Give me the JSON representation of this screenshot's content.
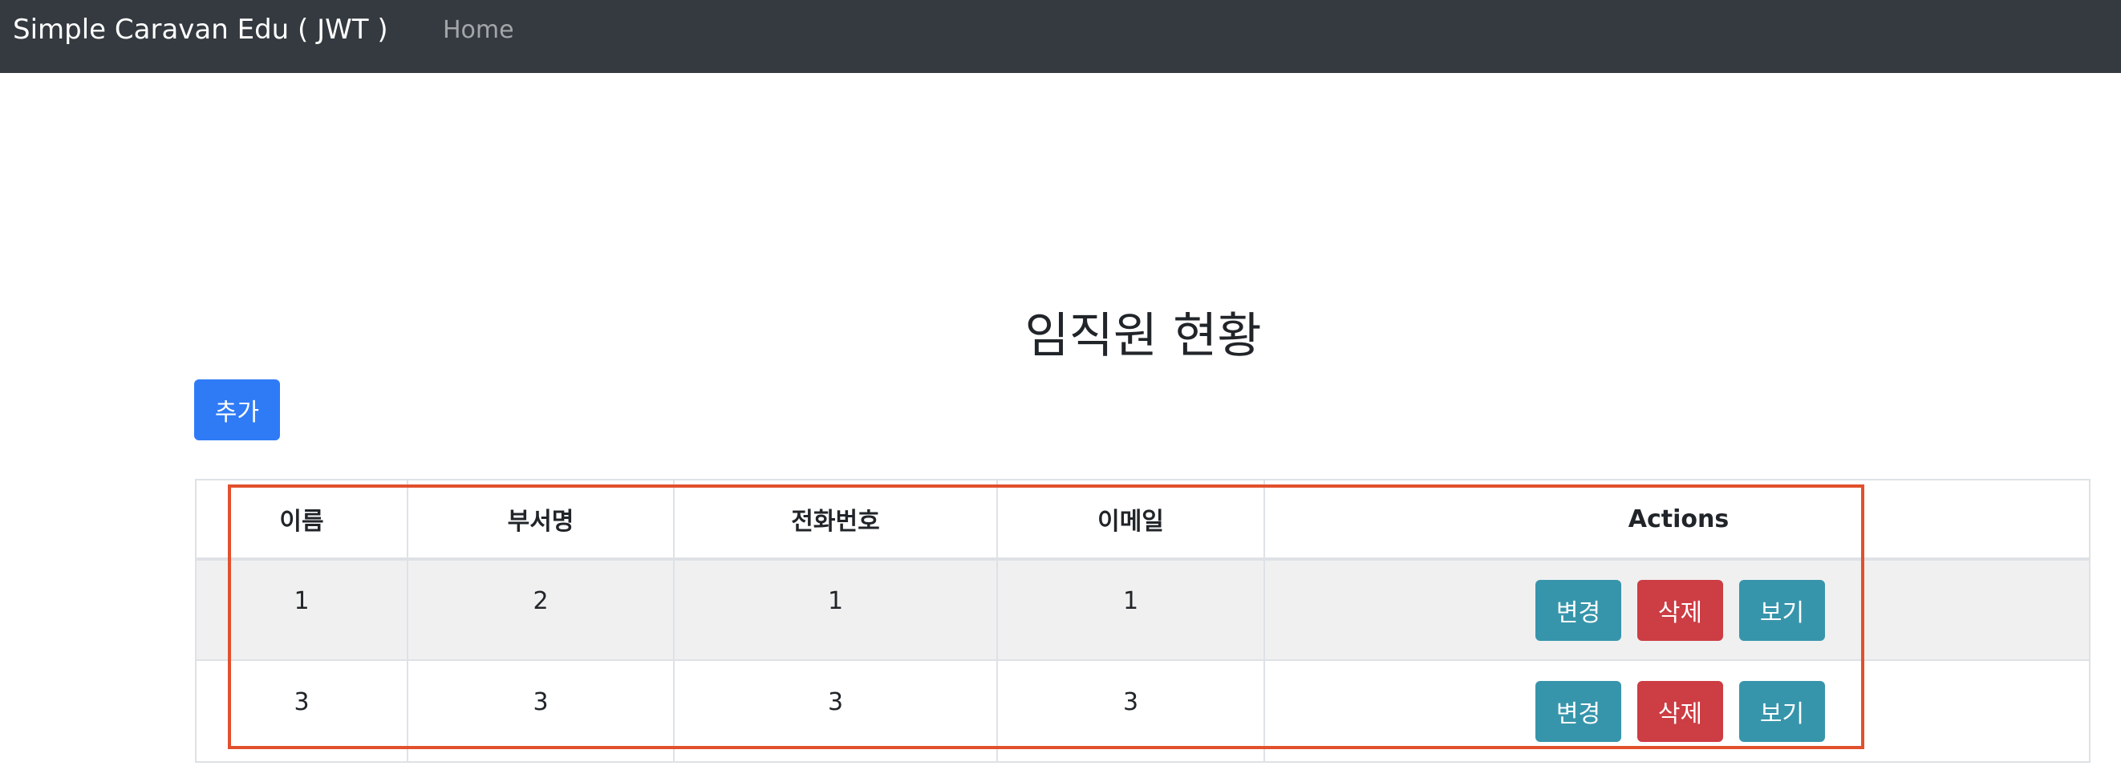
{
  "navbar": {
    "brand": "Simple Caravan Edu ( JWT )",
    "links": [
      {
        "label": "Home"
      }
    ]
  },
  "page": {
    "title": "임직원 현황",
    "add_label": "추가"
  },
  "table": {
    "headers": [
      "이름",
      "부서명",
      "전화번호",
      "이메일",
      "Actions"
    ],
    "rows": [
      {
        "cells": [
          "1",
          "2",
          "1",
          "1"
        ]
      },
      {
        "cells": [
          "3",
          "3",
          "3",
          "3"
        ]
      }
    ],
    "actions": {
      "edit_label": "변경",
      "delete_label": "삭제",
      "view_label": "보기"
    }
  },
  "colors": {
    "navbar_bg": "#343a40",
    "primary": "#2f7bf6",
    "info": "#3795ab",
    "danger": "#cc3d44",
    "highlight": "#e2502d",
    "stripe": "#f0f0f0"
  }
}
